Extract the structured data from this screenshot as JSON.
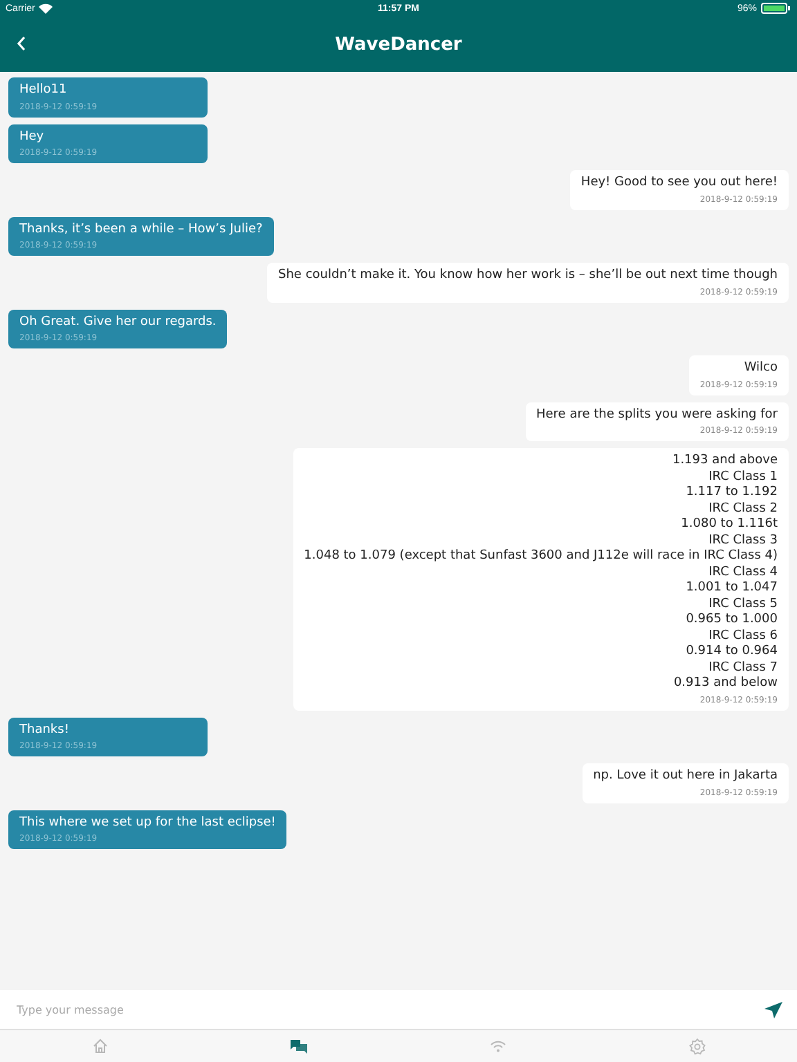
{
  "status_bar": {
    "carrier": "Carrier",
    "time": "11:57 PM",
    "battery": "96%"
  },
  "header": {
    "title": "WaveDancer"
  },
  "messages": [
    {
      "kind": "incoming",
      "lines": [
        "Hello11"
      ],
      "time": "2018-9-12 0:59:19"
    },
    {
      "kind": "incoming",
      "lines": [
        "Hey"
      ],
      "time": "2018-9-12 0:59:19"
    },
    {
      "kind": "outgoing",
      "lines": [
        "Hey! Good to see you out here!"
      ],
      "time": "2018-9-12 0:59:19"
    },
    {
      "kind": "incoming",
      "lines": [
        "Thanks, it’s been a while – How’s Julie?"
      ],
      "time": "2018-9-12 0:59:19"
    },
    {
      "kind": "outgoing",
      "lines": [
        "She couldn’t make it. You know how her work is – she’ll be out next time though"
      ],
      "time": "2018-9-12 0:59:19"
    },
    {
      "kind": "incoming",
      "lines": [
        "Oh Great. Give her our regards."
      ],
      "time": "2018-9-12 0:59:19"
    },
    {
      "kind": "outgoing",
      "lines": [
        "Wilco"
      ],
      "time": "2018-9-12 0:59:19"
    },
    {
      "kind": "outgoing",
      "lines": [
        "Here are the splits you were asking for"
      ],
      "time": "2018-9-12 0:59:19"
    },
    {
      "kind": "outgoing",
      "lines": [
        "1.193 and above",
        "IRC Class 1",
        "1.117 to 1.192",
        "IRC Class 2",
        "1.080 to 1.116t",
        "IRC Class 3",
        "1.048 to 1.079 (except that Sunfast 3600 and J112e will race in IRC Class 4)",
        "IRC Class 4",
        "1.001 to 1.047",
        "IRC Class 5",
        "0.965 to 1.000",
        "IRC Class 6",
        "0.914 to 0.964",
        "IRC Class 7",
        "0.913 and below"
      ],
      "time": "2018-9-12 0:59:19"
    },
    {
      "kind": "incoming",
      "lines": [
        "Thanks!"
      ],
      "time": "2018-9-12 0:59:19"
    },
    {
      "kind": "outgoing",
      "lines": [
        "np. Love it out here in Jakarta"
      ],
      "time": "2018-9-12 0:59:19"
    },
    {
      "kind": "incoming",
      "lines": [
        "This where we set up for the last eclipse!"
      ],
      "time": "2018-9-12 0:59:19"
    }
  ],
  "composer": {
    "placeholder": "Type your message"
  },
  "tab_bar": [
    {
      "kind": "home",
      "selected": false
    },
    {
      "kind": "chat",
      "selected": true
    },
    {
      "kind": "wifi",
      "selected": false
    },
    {
      "kind": "settings",
      "selected": false
    }
  ]
}
